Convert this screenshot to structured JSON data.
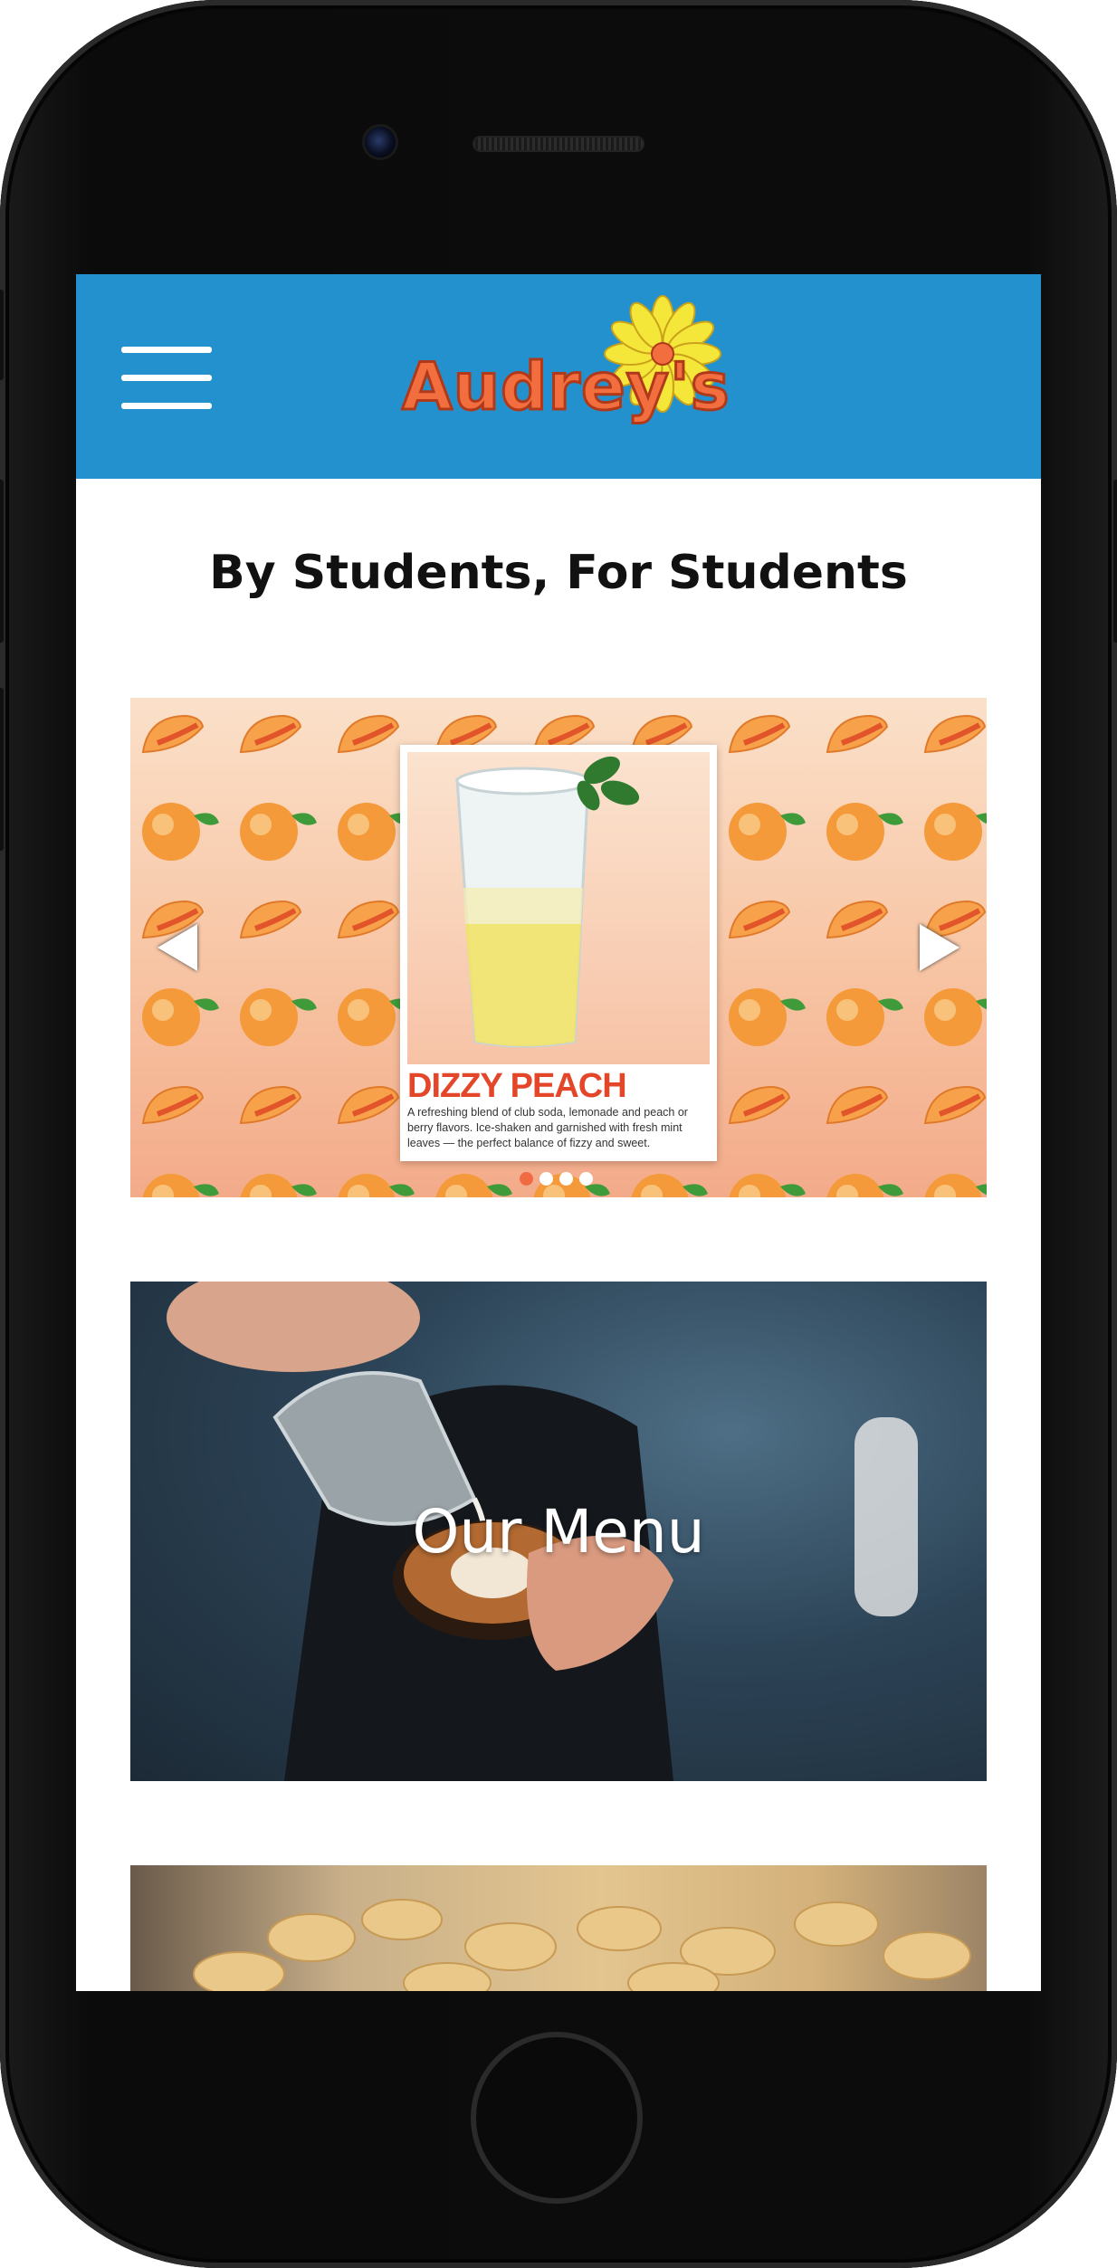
{
  "header": {
    "brand": "Audrey's",
    "brand_color": "#f26e3f",
    "header_color": "#2491cf",
    "menu_icon": "hamburger-icon"
  },
  "tagline": "By Students, For Students",
  "slider": {
    "slide": {
      "title": "DIZZY PEACH",
      "description": "A refreshing blend of club soda, lemonade and peach or berry flavors. Ice-shaken and garnished with fresh mint leaves — the perfect balance of fizzy and sweet."
    },
    "prev_icon": "triangle-left-icon",
    "next_icon": "triangle-right-icon",
    "dot_count": 4,
    "active_dot": 1,
    "accent": "#f06a42"
  },
  "tiles": {
    "menu_label": "Our Menu"
  }
}
